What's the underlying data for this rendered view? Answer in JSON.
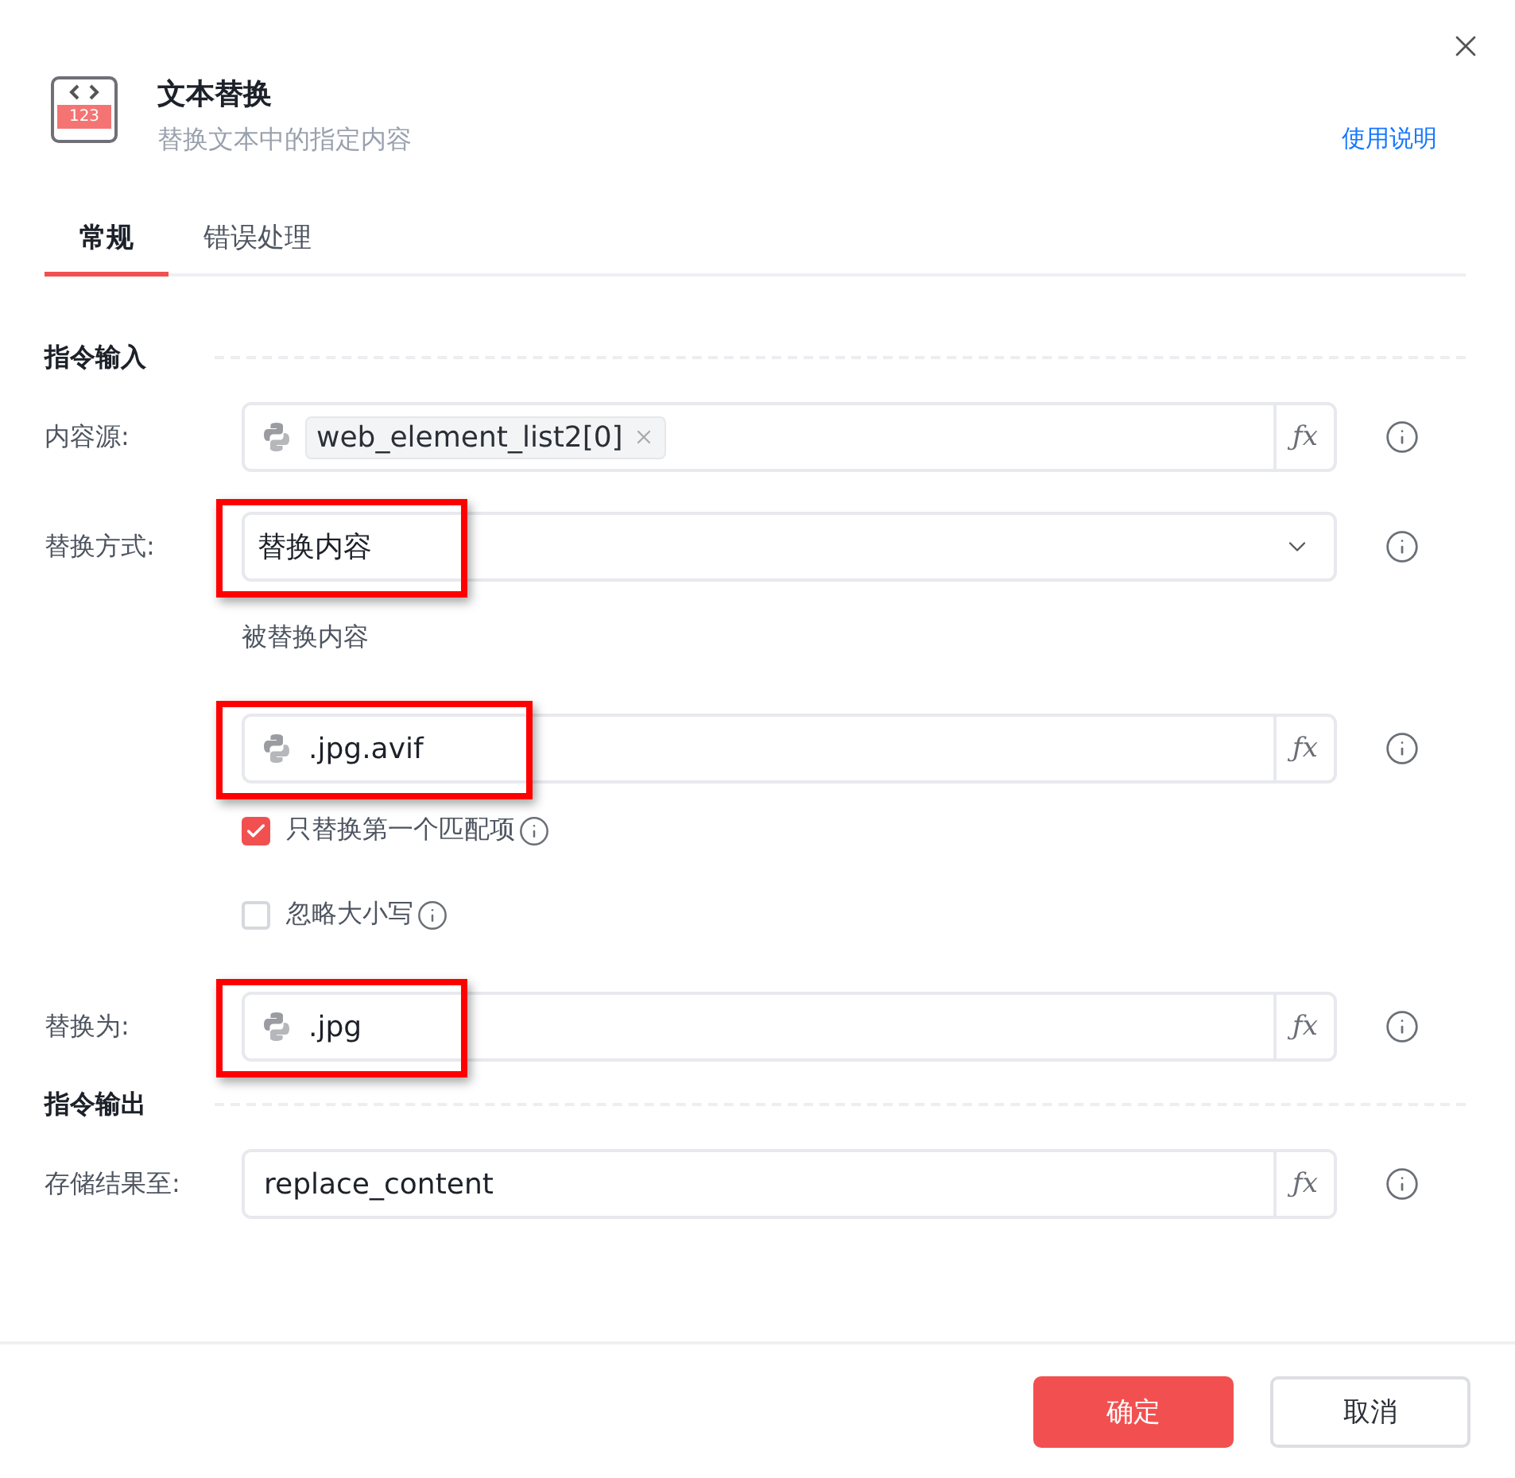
{
  "header": {
    "logo_text": "123",
    "title": "文本替换",
    "subtitle": "替换文本中的指定内容",
    "help_link": "使用说明"
  },
  "tabs": [
    {
      "label": "常规",
      "selected": true
    },
    {
      "label": "错误处理",
      "selected": false
    }
  ],
  "sections": [
    {
      "title": "指令输入",
      "rows": [
        {
          "kind": "token_field",
          "label": "内容源:",
          "python_icon": true,
          "value": "web_element_list2[0]",
          "formula_button": "ƒx",
          "highlighted": false
        },
        {
          "kind": "select",
          "label": "替换方式:",
          "value": "替换内容",
          "highlighted": true
        },
        {
          "kind": "caption",
          "text": "被替换内容"
        },
        {
          "kind": "field",
          "python_icon": true,
          "value": ".jpg.avif",
          "formula_button": "ƒx",
          "highlighted": true
        },
        {
          "kind": "checkbox",
          "label": "只替换第一个匹配项",
          "checked": true
        },
        {
          "kind": "checkbox",
          "label": "忽略大小写",
          "checked": false
        },
        {
          "kind": "field",
          "label": "替换为:",
          "python_icon": true,
          "value": ".jpg",
          "formula_button": "ƒx",
          "highlighted": true
        }
      ]
    },
    {
      "title": "指令输出",
      "rows": [
        {
          "kind": "field",
          "label": "存储结果至:",
          "python_icon": false,
          "value": "replace_content",
          "formula_button": "ƒx",
          "highlighted": false
        }
      ]
    }
  ],
  "buttons": [
    {
      "label": "确定",
      "kind": "primary"
    },
    {
      "label": "取消",
      "kind": "secondary"
    }
  ]
}
